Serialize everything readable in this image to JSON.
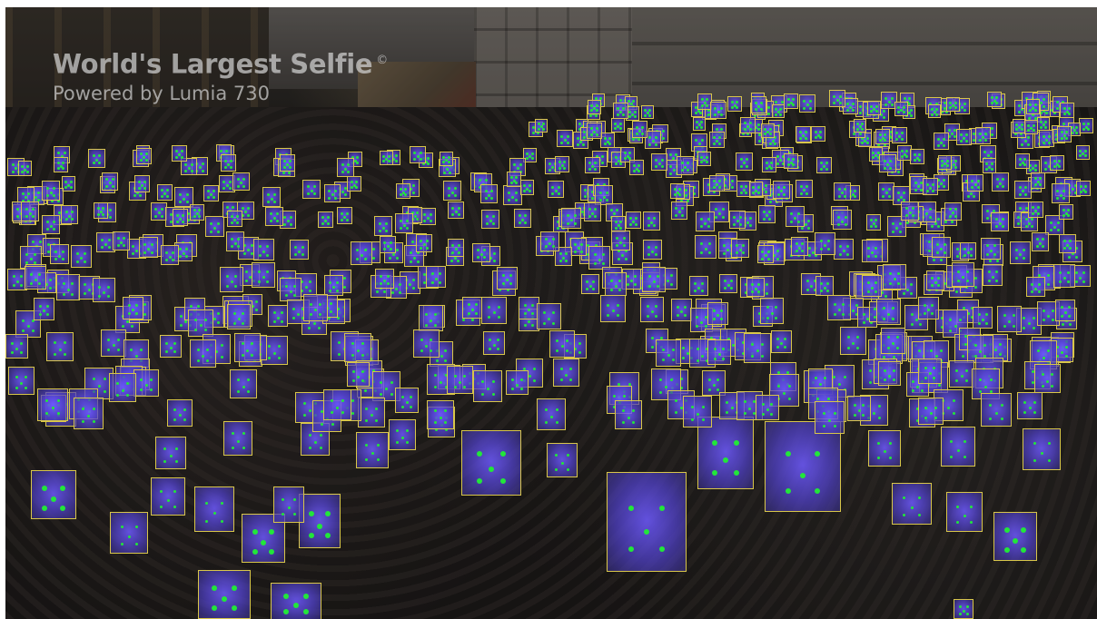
{
  "overlay": {
    "title": "World's Largest Selfie",
    "title_mark": "©",
    "subtitle": "Powered by Lumia 730"
  },
  "detection_style": {
    "box_color": "#d8c64a",
    "landmark_color": "#22e63a",
    "face_tint": "#6e5aff"
  }
}
